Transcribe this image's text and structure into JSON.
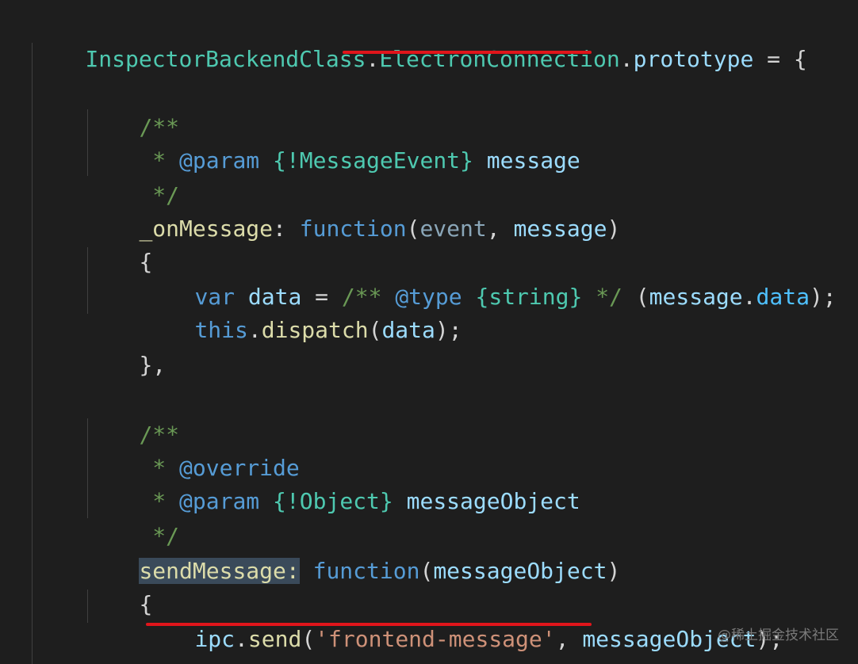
{
  "code": {
    "l1": {
      "a": "InspectorBackendClass",
      "b": ".",
      "c": "ElectronConnection",
      "d": ".",
      "e": "prototype",
      "f": " = {"
    },
    "l3": {
      "a": "/**"
    },
    "l4": {
      "a": " * ",
      "b": "@param",
      "c": " ",
      "d": "{!MessageEvent}",
      "e": " message"
    },
    "l5": {
      "a": " */"
    },
    "l6": {
      "a": "_onMessage",
      "b": ": ",
      "c": "function",
      "d": "(",
      "e": "event",
      "f": ", ",
      "g": "message",
      "h": ")"
    },
    "l7": {
      "a": "{"
    },
    "l8": {
      "a": "var",
      "b": " ",
      "c": "data",
      "d": " = ",
      "e": "/** ",
      "f": "@type",
      "g": " ",
      "h": "{string}",
      "i": " */",
      "j": " (",
      "k": "message",
      "l": ".",
      "m": "data",
      "n": ");"
    },
    "l9": {
      "a": "this",
      "b": ".",
      "c": "dispatch",
      "d": "(",
      "e": "data",
      "f": ");"
    },
    "l10": {
      "a": "},"
    },
    "l12": {
      "a": "/**"
    },
    "l13": {
      "a": " * ",
      "b": "@override"
    },
    "l14": {
      "a": " * ",
      "b": "@param",
      "c": " ",
      "d": "{!Object}",
      "e": " messageObject"
    },
    "l15": {
      "a": " */"
    },
    "l16": {
      "a": "sendMessage:",
      "b": " ",
      "c": "function",
      "d": "(",
      "e": "messageObject",
      "f": ")"
    },
    "l17": {
      "a": "{"
    },
    "l18": {
      "a": "ipc",
      "b": ".",
      "c": "send",
      "d": "(",
      "e": "'frontend-message'",
      "f": ", ",
      "g": "messageObject",
      "h": ");"
    },
    "l19": {
      "a": "},"
    }
  },
  "watermark": "@稀土掘金技术社区",
  "colors": {
    "background": "#1e1e1e",
    "underline": "#e0151b",
    "class": "#4ec9b0",
    "property": "#9cdcfe",
    "comment": "#6a9955",
    "keyword": "#569cd6",
    "function": "#dcdcaa",
    "string": "#ce9178"
  }
}
